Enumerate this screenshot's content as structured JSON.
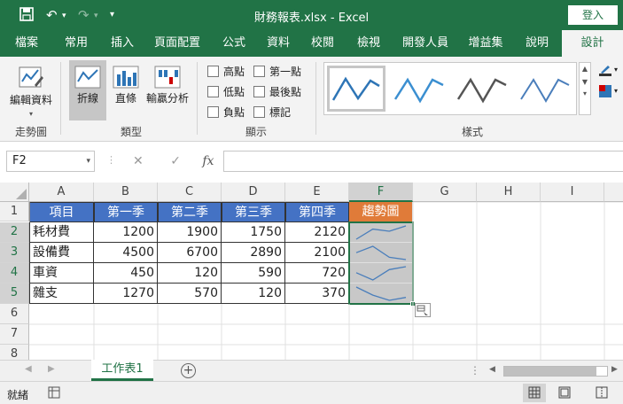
{
  "window": {
    "title": "財務報表.xlsx - Excel",
    "login_label": "登入"
  },
  "tabs": [
    "檔案",
    "常用",
    "插入",
    "頁面配置",
    "公式",
    "資料",
    "校閱",
    "檢視",
    "開發人員",
    "增益集",
    "說明",
    "設計"
  ],
  "ribbon": {
    "edit_data": "編輯資料",
    "type_buttons": [
      "折線",
      "直條",
      "輸贏分析"
    ],
    "show_checkboxes": [
      "高點",
      "低點",
      "負點",
      "第一點",
      "最後點",
      "標記"
    ],
    "groups": [
      "走勢圖",
      "類型",
      "顯示",
      "樣式"
    ]
  },
  "formula_bar": {
    "name_box": "F2",
    "fx": "fx",
    "value": ""
  },
  "columns": [
    "A",
    "B",
    "C",
    "D",
    "E",
    "F",
    "G",
    "H",
    "I"
  ],
  "rows": [
    "1",
    "2",
    "3",
    "4",
    "5",
    "6",
    "7",
    "8"
  ],
  "table": {
    "headers": [
      "項目",
      "第一季",
      "第二季",
      "第三季",
      "第四季",
      "趨勢圖"
    ],
    "data": [
      [
        "耗材費",
        "1200",
        "1900",
        "1750",
        "2120"
      ],
      [
        "設備費",
        "4500",
        "6700",
        "2890",
        "2100"
      ],
      [
        "車資",
        "450",
        "120",
        "590",
        "720"
      ],
      [
        "雜支",
        "1270",
        "570",
        "120",
        "370"
      ]
    ]
  },
  "sparklines": [
    [
      1200,
      1900,
      1750,
      2120
    ],
    [
      4500,
      6700,
      2890,
      2100
    ],
    [
      450,
      120,
      590,
      720
    ],
    [
      1270,
      570,
      120,
      370
    ]
  ],
  "sheet_tab": "工作表1",
  "status": {
    "ready": "就緒"
  },
  "colors": {
    "excel_green": "#217346",
    "header_blue": "#4472c4",
    "trend_orange": "#e07b39",
    "sparkline": "#4a7ebb"
  }
}
